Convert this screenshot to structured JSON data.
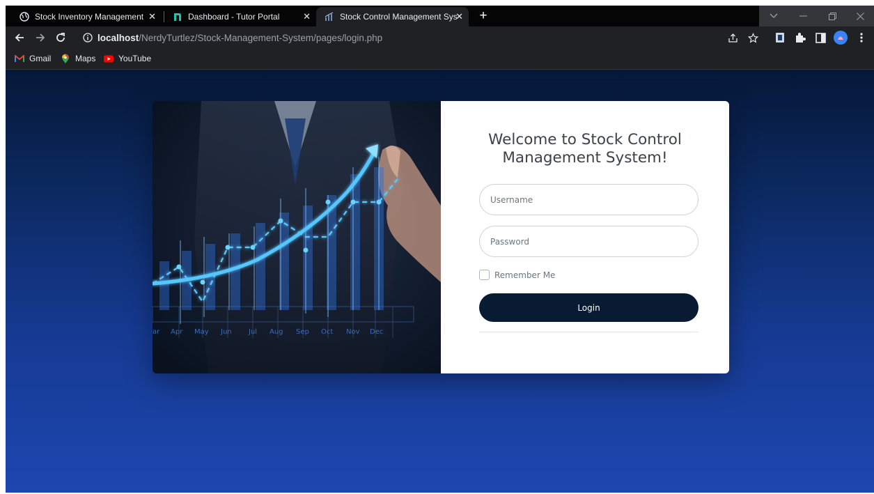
{
  "browser": {
    "tabs": [
      {
        "title": "Stock Inventory Management Sy",
        "favicon": "globe-icon",
        "active": false
      },
      {
        "title": "Dashboard - Tutor Portal",
        "favicon": "portal-icon",
        "active": false
      },
      {
        "title": "Stock Control Management Syste",
        "favicon": "chart-favicon",
        "active": true
      }
    ],
    "new_tab_label": "+",
    "address": {
      "host": "localhost",
      "path": "/NerdyTurtlez/Stock-Management-System/pages/login.php"
    },
    "bookmarks": [
      {
        "label": "Gmail",
        "icon": "gmail-icon"
      },
      {
        "label": "Maps",
        "icon": "maps-icon"
      },
      {
        "label": "YouTube",
        "icon": "youtube-icon"
      }
    ]
  },
  "hero": {
    "months": [
      "ar",
      "Apr",
      "May",
      "Jun",
      "Jul",
      "Aug",
      "Sep",
      "Oct",
      "Nov",
      "Dec"
    ]
  },
  "login": {
    "welcome": "Welcome to Stock Control Management System!",
    "username_placeholder": "Username",
    "password_placeholder": "Password",
    "remember_label": "Remember Me",
    "login_button": "Login"
  },
  "colors": {
    "page_top": "#061838",
    "page_bottom": "#1d47b0",
    "button": "#081b33",
    "accent_glow": "#3fa9ff"
  }
}
